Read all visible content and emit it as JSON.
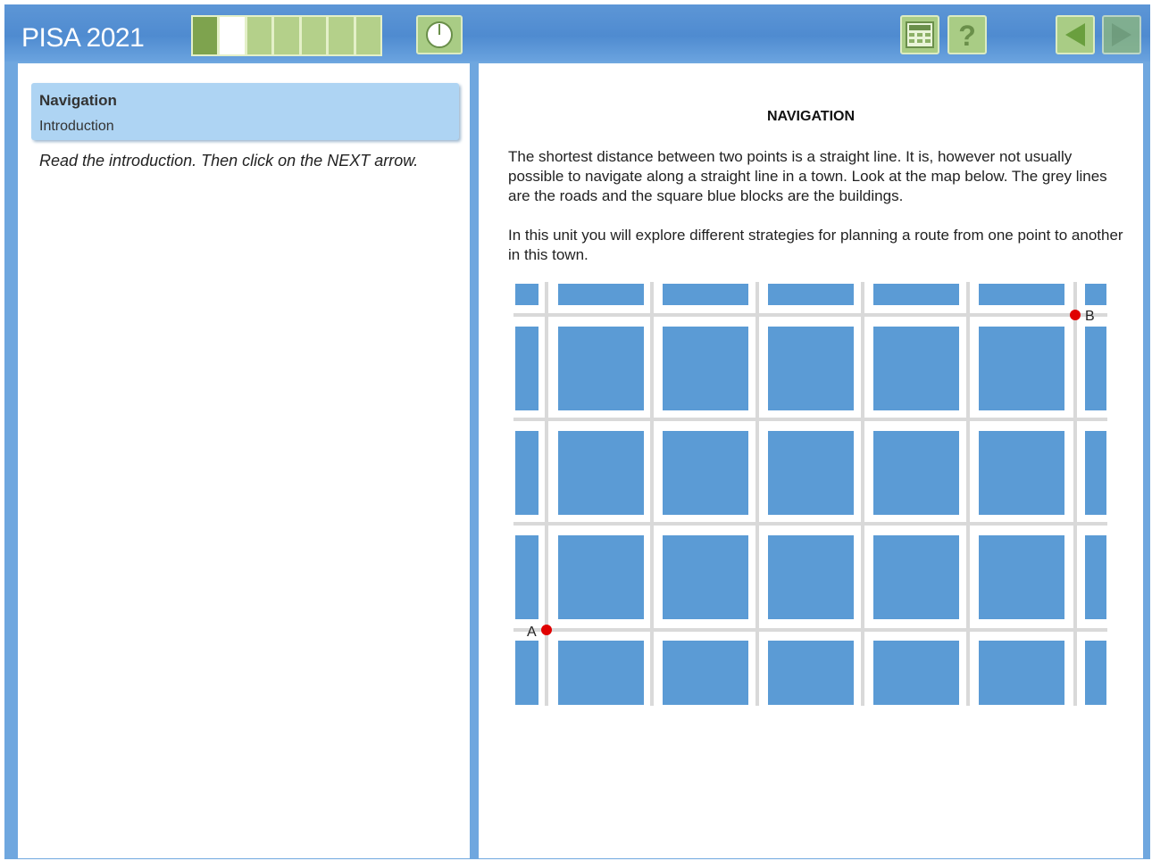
{
  "header": {
    "title": "PISA 2021",
    "progress": {
      "total_segments": 7,
      "completed": 1,
      "current": 2
    }
  },
  "left": {
    "unit_title": "Navigation",
    "section": "Introduction",
    "instruction": "Read the introduction. Then click on the NEXT arrow."
  },
  "right": {
    "title": "NAVIGATION",
    "paragraph1": "The shortest distance between two points is a straight line. It is, however not usually possible to navigate along a straight line in a town. Look at the map below. The grey lines are the roads and the square blue blocks are the buildings.",
    "paragraph2": "In this unit you will explore different strategies for planning a route from one point to another in this town."
  },
  "map": {
    "point_a_label": "A",
    "point_b_label": "B",
    "building_color": "#5b9bd5",
    "road_color": "#d9d9d9",
    "marker_color": "#e00000"
  },
  "colors": {
    "frame": "#6fa7df",
    "crumb": "#aed4f3",
    "button": "#a9cc85"
  }
}
